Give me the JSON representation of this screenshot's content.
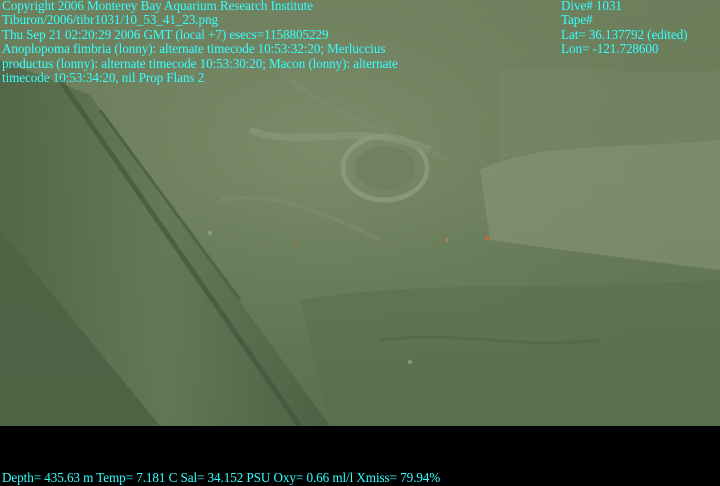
{
  "overlay_left": {
    "copyright": "Copyright 2006 Monterey Bay Aquarium Research Institute",
    "file_path": "Tiburon/2006/tibr1031/10_53_41_23.png",
    "datetime": "Thu Sep 21 02:20:29 2006 GMT (local +7)  esecs=1158805229",
    "annotation_line1": "Anoplopoma fimbria (lonny): alternate timecode 10:53:32:20; Merluccius",
    "annotation_line2": "productus (lonny): alternate timecode 10:53:30:20; Macon (lonny): alternate",
    "annotation_line3": "timecode 10:53:34:20, nil Prop Flans 2"
  },
  "overlay_right": {
    "dive": "Dive# 1031",
    "tape": "Tape#",
    "lat": "Lat= 36.137792 (edited)",
    "lon": "Lon= -121.728600"
  },
  "overlay_bottom": {
    "sensors": "Depth= 435.63 m  Temp= 7.181 C  Sal= 34.152 PSU  Oxy= 0.66 ml/l  Xmiss= 79.94%"
  },
  "colors": {
    "overlay_text": "#33ffff",
    "water": "#6a7b58",
    "background": "#000000"
  }
}
